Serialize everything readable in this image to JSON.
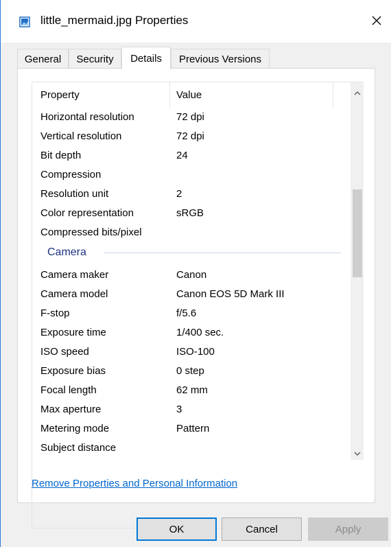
{
  "window": {
    "title": "little_mermaid.jpg Properties",
    "accent_color": "#0078d7",
    "icon": "image-file-icon",
    "close_icon": "close-icon"
  },
  "tabs": [
    {
      "label": "General",
      "active": false
    },
    {
      "label": "Security",
      "active": false
    },
    {
      "label": "Details",
      "active": true
    },
    {
      "label": "Previous Versions",
      "active": false
    }
  ],
  "details": {
    "header": {
      "property": "Property",
      "value": "Value"
    },
    "image_rows": [
      {
        "property": "Horizontal resolution",
        "value": "72 dpi"
      },
      {
        "property": "Vertical resolution",
        "value": "72 dpi"
      },
      {
        "property": "Bit depth",
        "value": "24"
      },
      {
        "property": "Compression",
        "value": ""
      },
      {
        "property": "Resolution unit",
        "value": "2"
      },
      {
        "property": "Color representation",
        "value": "sRGB"
      },
      {
        "property": "Compressed bits/pixel",
        "value": ""
      }
    ],
    "camera_group": "Camera",
    "camera_rows": [
      {
        "property": "Camera maker",
        "value": "Canon"
      },
      {
        "property": "Camera model",
        "value": "Canon EOS 5D Mark III"
      },
      {
        "property": "F-stop",
        "value": "f/5.6"
      },
      {
        "property": "Exposure time",
        "value": "1/400 sec."
      },
      {
        "property": "ISO speed",
        "value": "ISO-100"
      },
      {
        "property": "Exposure bias",
        "value": "0 step"
      },
      {
        "property": "Focal length",
        "value": "62 mm"
      },
      {
        "property": "Max aperture",
        "value": "3"
      },
      {
        "property": "Metering mode",
        "value": "Pattern"
      },
      {
        "property": "Subject distance",
        "value": ""
      }
    ]
  },
  "remove_link": "Remove Properties and Personal Information",
  "buttons": {
    "ok": "OK",
    "cancel": "Cancel",
    "apply": "Apply"
  }
}
